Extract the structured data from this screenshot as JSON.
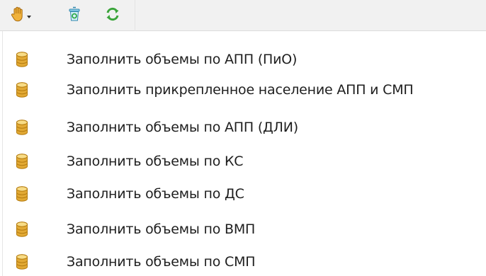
{
  "toolbar": {
    "buttons": [
      {
        "icon": "hand-icon",
        "has_dropdown": true
      },
      {
        "icon": "recycle-bin-icon"
      },
      {
        "icon": "refresh-icon"
      }
    ]
  },
  "menu": {
    "items": [
      {
        "label": "Заполнить объемы по АПП (ПиО)",
        "icon": "database-icon"
      },
      {
        "label": "Заполнить прикрепленное население АПП и СМП",
        "icon": "database-icon"
      },
      {
        "label": "Заполнить объемы по АПП (ДЛИ)",
        "icon": "database-icon"
      },
      {
        "label": "Заполнить объемы по КС",
        "icon": "database-icon"
      },
      {
        "label": "Заполнить объемы по ДС",
        "icon": "database-icon"
      },
      {
        "label": "Заполнить объемы по ВМП",
        "icon": "database-icon"
      },
      {
        "label": "Заполнить объемы по СМП",
        "icon": "database-icon"
      }
    ]
  },
  "colors": {
    "toolbar_bg": "#f1f1f1",
    "icon_gold": "#e2a934",
    "icon_green": "#3aa43a",
    "icon_teal": "#3fa3c8"
  }
}
